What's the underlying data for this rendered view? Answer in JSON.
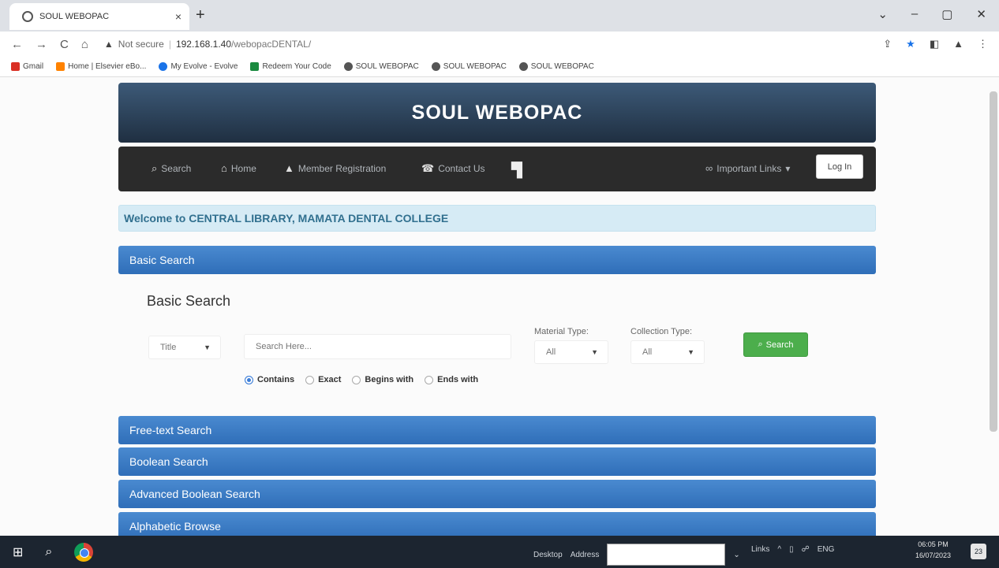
{
  "browser": {
    "tab_title": "SOUL WEBOPAC",
    "tab_close": "×",
    "new_tab": "+",
    "window_controls": [
      "⌄",
      "–",
      "▢",
      "✕"
    ],
    "nav_buttons": [
      "←",
      "→",
      "C",
      "⌂"
    ],
    "security_label": "Not secure",
    "url_host": "192.168.1.40",
    "url_path": "/webopacDENTAL/",
    "right_icons": [
      "⇪",
      "★",
      "◧",
      "▲",
      "⋮"
    ],
    "bookmarks": [
      {
        "label": "Gmail",
        "color": "#d93025"
      },
      {
        "label": "Home | Elsevier eBo...",
        "color": "#ff8200"
      },
      {
        "label": "My Evolve - Evolve",
        "color": "#1a73e8"
      },
      {
        "label": "Redeem Your Code",
        "color": "#1a8a3f"
      },
      {
        "label": "SOUL WEBOPAC",
        "color": "#555555"
      },
      {
        "label": "SOUL WEBOPAC",
        "color": "#555555"
      },
      {
        "label": "SOUL WEBOPAC",
        "color": "#555555"
      }
    ]
  },
  "site": {
    "banner_title": "SOUL WEBOPAC",
    "nav": {
      "search": "Search",
      "home": "Home",
      "member_registration": "Member Registration",
      "contact_us": "Contact Us",
      "important_links": "Important Links",
      "login": "Log In"
    },
    "welcome": "Welcome to CENTRAL LIBRARY, MAMATA DENTAL COLLEGE"
  },
  "basic_search": {
    "panel_title": "Basic Search",
    "title": "Basic Search",
    "field_select": "Title",
    "search_placeholder": "Search Here...",
    "material_type_label": "Material Type:",
    "material_type_value": "All",
    "collection_type_label": "Collection Type:",
    "collection_type_value": "All",
    "search_button": "Search",
    "options": [
      {
        "label": "Contains",
        "selected": true
      },
      {
        "label": "Exact",
        "selected": false
      },
      {
        "label": "Begins with",
        "selected": false
      },
      {
        "label": "Ends with",
        "selected": false
      }
    ]
  },
  "panels": [
    "Free-text Search",
    "Boolean Search",
    "Advanced Boolean Search",
    "Alphabetic Browse"
  ],
  "taskbar": {
    "desktop": "Desktop",
    "address": "Address",
    "links": "Links",
    "lang": "ENG",
    "time": "06:05 PM",
    "date": "16/07/2023",
    "notification_count": "23"
  },
  "colors": {
    "accent_blue": "#2f6eb8",
    "search_green": "#4cae4c",
    "navbar_dark": "#2b2b2b",
    "welcome_text": "#31708f"
  }
}
